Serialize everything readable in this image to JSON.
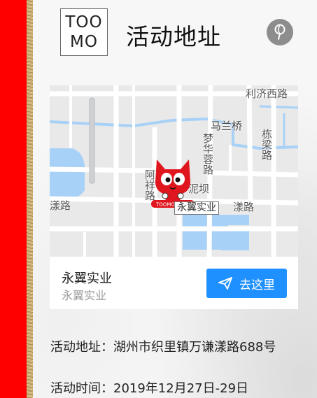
{
  "header": {
    "logo_line1": "TOO",
    "logo_line2": "MO",
    "title": "活动地址"
  },
  "map": {
    "labels": {
      "road_top_right": "利济西路",
      "bridge": "马兰桥",
      "road_vertical_1": "梦华蓉路",
      "road_vertical_2": "栋梁路",
      "road_left": "漾路",
      "road_right": "漾路",
      "road_vertical_3": "阿祥路",
      "road_mid": "泥坝",
      "marker_label": "永翼实业",
      "mascot_text": "TOOMO淘陌猫"
    }
  },
  "location": {
    "name": "永翼实业",
    "address": "永翼实业",
    "go_label": "去这里"
  },
  "event": {
    "address_line": "活动地址：湖州市织里镇万谦漾路688号",
    "time_line": "活动时间：2019年12月27日-29日"
  },
  "colors": {
    "accent": "#1e90ff",
    "side_bar": "#ff0000"
  }
}
